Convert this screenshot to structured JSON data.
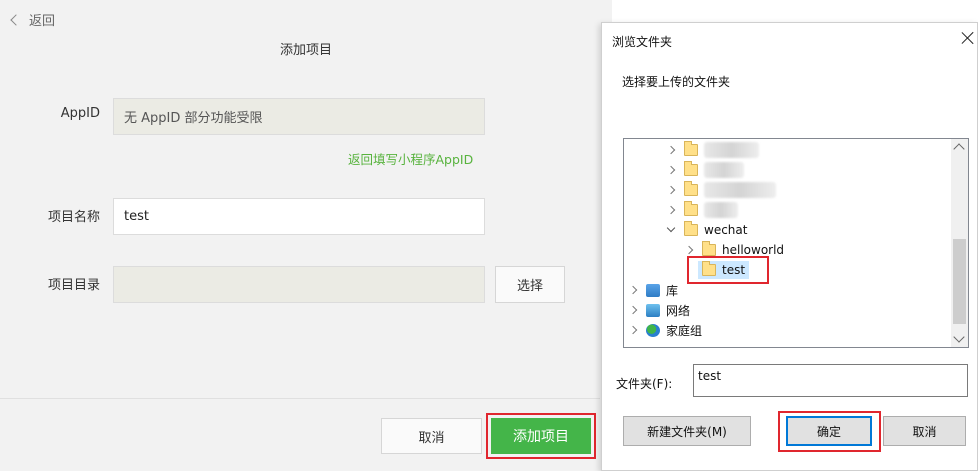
{
  "left": {
    "back_label": "返回",
    "page_title": "添加项目",
    "appid_label": "AppID",
    "appid_value": "无 AppID 部分功能受限",
    "appid_link": "返回填写小程序AppID",
    "project_name_label": "项目名称",
    "project_name_value": "test",
    "project_dir_label": "项目目录",
    "project_dir_value": "",
    "choose_label": "选择",
    "cancel_label": "取消",
    "add_label": "添加项目"
  },
  "dialog": {
    "title": "浏览文件夹",
    "prompt": "选择要上传的文件夹",
    "tree": {
      "wechat": "wechat",
      "helloworld": "helloworld",
      "test": "test",
      "library": "库",
      "network": "网络",
      "homegroup": "家庭组"
    },
    "folder_label": "文件夹(F):",
    "folder_value": "test",
    "new_folder_label": "新建文件夹(M)",
    "ok_label": "确定",
    "cancel_label": "取消"
  },
  "colors": {
    "accent_green": "#44b549",
    "link_green": "#58b33e",
    "highlight_red": "#e0262e",
    "selection_blue": "#cce8ff"
  }
}
